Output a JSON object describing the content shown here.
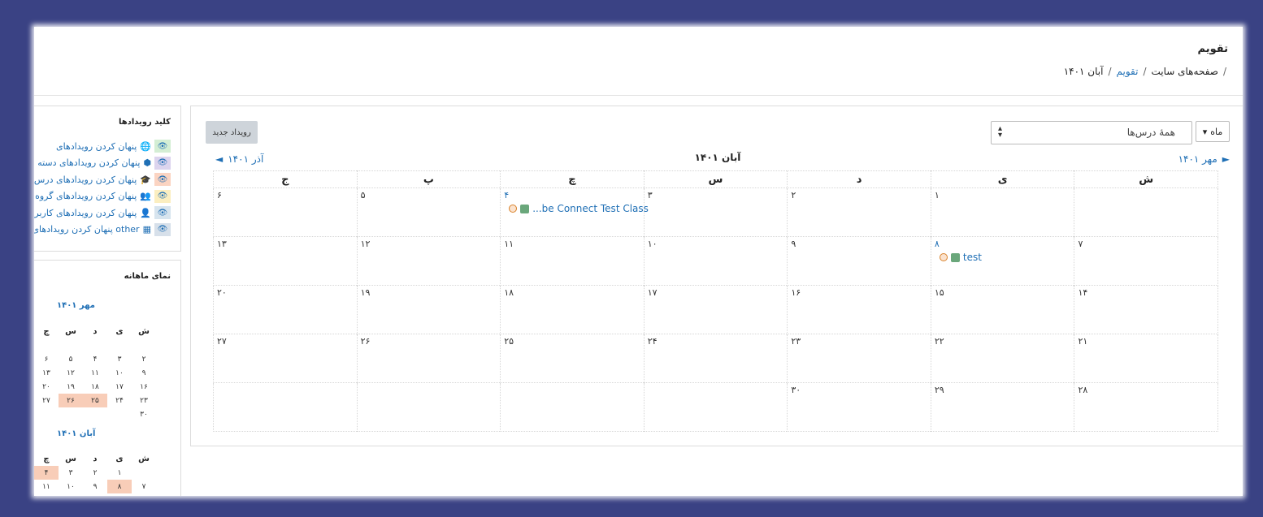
{
  "page": {
    "title": "تقویم"
  },
  "breadcrumb": {
    "items": [
      "صفحه‌های سایت",
      "تقویم",
      "آبان ۱۴۰۱"
    ],
    "sep": "/"
  },
  "toolbar": {
    "view_label": "ماه",
    "view_caret": "▾",
    "course_select": "همهٔ درس‌ها",
    "course_caret": "▲\n▼",
    "new_event": "رویداد جدید"
  },
  "month": {
    "title": "آبان ۱۴۰۱",
    "prev": "مهر ۱۴۰۱",
    "prev_arrow": "►",
    "next": "آذر ۱۴۰۱",
    "next_arrow": "◄"
  },
  "weekdays": [
    "ش",
    "ی",
    "د",
    "س",
    "چ",
    "پ",
    "ج"
  ],
  "weeks": [
    [
      {
        "d": ""
      },
      {
        "d": "۱"
      },
      {
        "d": "۲"
      },
      {
        "d": "۳"
      },
      {
        "d": "۴",
        "link": true,
        "event": "be Connect Test Class..."
      },
      {
        "d": "۵"
      },
      {
        "d": "۶"
      }
    ],
    [
      {
        "d": "۷"
      },
      {
        "d": "۸",
        "link": true,
        "event": "test"
      },
      {
        "d": "۹"
      },
      {
        "d": "۱۰"
      },
      {
        "d": "۱۱"
      },
      {
        "d": "۱۲"
      },
      {
        "d": "۱۳"
      }
    ],
    [
      {
        "d": "۱۴"
      },
      {
        "d": "۱۵"
      },
      {
        "d": "۱۶"
      },
      {
        "d": "۱۷"
      },
      {
        "d": "۱۸"
      },
      {
        "d": "۱۹"
      },
      {
        "d": "۲۰"
      }
    ],
    [
      {
        "d": "۲۱"
      },
      {
        "d": "۲۲"
      },
      {
        "d": "۲۳"
      },
      {
        "d": "۲۴"
      },
      {
        "d": "۲۵"
      },
      {
        "d": "۲۶"
      },
      {
        "d": "۲۷"
      }
    ],
    [
      {
        "d": "۲۸"
      },
      {
        "d": "۲۹"
      },
      {
        "d": "۳۰"
      },
      {
        "d": ""
      },
      {
        "d": ""
      },
      {
        "d": ""
      },
      {
        "d": ""
      }
    ]
  ],
  "legend": {
    "title": "کلید رویدادها",
    "items": [
      {
        "label": "پنهان کردن رویدادهای",
        "icon": "globe-icon",
        "glyph": "🌐",
        "bg": "#d4eed4"
      },
      {
        "label": "پنهان کردن رویدادهای دسته",
        "icon": "cubes-icon",
        "glyph": "⬢",
        "bg": "#dcd4ee"
      },
      {
        "label": "پنهان کردن رویدادهای درس",
        "icon": "graduation-cap-icon",
        "glyph": "🎓",
        "bg": "#fbd4c2"
      },
      {
        "label": "پنهان کردن رویدادهای گروه",
        "icon": "users-icon",
        "glyph": "👥",
        "bg": "#fbeec0"
      },
      {
        "label": "پنهان کردن رویدادهای کاربر",
        "icon": "user-icon",
        "glyph": "👤",
        "bg": "#d7e4ee"
      },
      {
        "label": "پنهان کردن رویدادهای other",
        "icon": "calendar-icon",
        "glyph": "▦",
        "bg": "#d7e0ea"
      }
    ],
    "eye_glyph": "👁"
  },
  "monthly_view": {
    "title": "نمای ماهانه",
    "mehr": {
      "title": "مهر ۱۴۰۱",
      "rows": [
        [
          "",
          "",
          "",
          "",
          "",
          "",
          ""
        ],
        [
          "۲",
          "۳",
          "۴",
          "۵",
          "۶",
          "",
          ""
        ],
        [
          "۹",
          "۱۰",
          "۱۱",
          "۱۲",
          "۱۳",
          "",
          ""
        ],
        [
          "۱۶",
          "۱۷",
          "۱۸",
          "۱۹",
          "۲۰",
          "",
          ""
        ],
        [
          "۲۳",
          "۲۴",
          "۲۵",
          "۲۶",
          "۲۷",
          "",
          ""
        ],
        [
          "۳۰",
          "",
          "",
          "",
          "",
          "",
          ""
        ]
      ]
    },
    "aban": {
      "title": "آبان ۱۴۰۱",
      "rows": [
        [
          "",
          "۱",
          "۲",
          "۳",
          "۴",
          "",
          ""
        ],
        [
          "۷",
          "۸",
          "۹",
          "۱۰",
          "۱۱",
          "",
          ""
        ]
      ]
    }
  }
}
